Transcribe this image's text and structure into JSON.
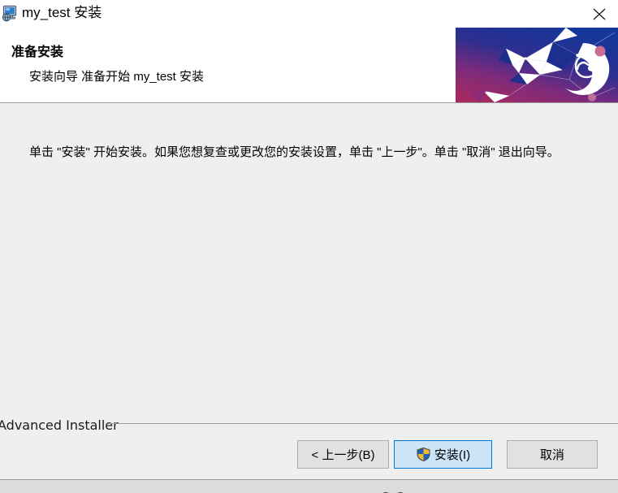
{
  "window": {
    "title": "my_test 安装",
    "icon": "installer-computer-icon",
    "close_label": "×"
  },
  "header": {
    "title": "准备安装",
    "subtitle": "安装向导 准备开始 my_test 安装",
    "banner_icon": "puzzle-piece-polygon-graphic",
    "banner_colors": {
      "blue": "#1f3f9e",
      "deep_blue": "#173a8f",
      "magenta": "#9c2a63",
      "purple": "#7a2a7a",
      "accent_dot": "#c46e8e"
    }
  },
  "main": {
    "body_text": "单击 \"安装\" 开始安装。如果您想复查或更改您的安装设置，单击 \"上一步\"。单击 \"取消\" 退出向导。"
  },
  "footer": {
    "brand": "Advanced Installer",
    "buttons": {
      "back": "< 上一步(B)",
      "install": "安装(I)",
      "cancel": "取消"
    },
    "install_icon": "uac-shield-icon",
    "install_focused": true,
    "accent_color": "#0078d7",
    "focus_fill": "#cce4f7"
  }
}
